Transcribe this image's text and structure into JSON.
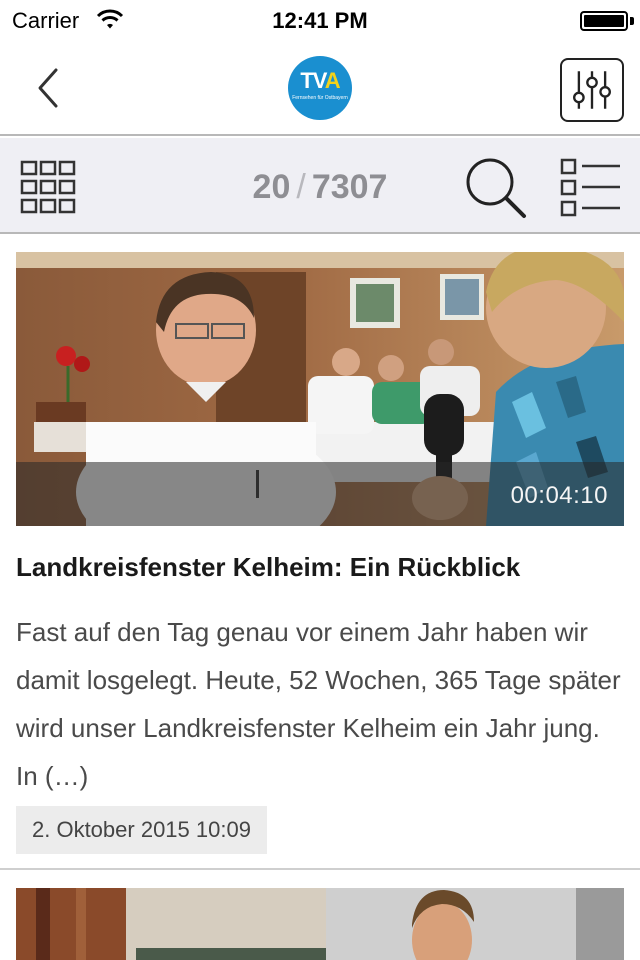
{
  "status_bar": {
    "carrier": "Carrier",
    "time": "12:41 PM",
    "icons": [
      "wifi-icon",
      "battery-icon"
    ]
  },
  "nav": {
    "back_icon": "chevron-left-icon",
    "logo": {
      "text_main": "TV",
      "text_accent": "A",
      "subtitle": "Fernsehen für Ostbayern"
    },
    "filter_icon": "sliders-icon"
  },
  "toolbar": {
    "grid_icon": "grid-icon",
    "current": "20",
    "separator": "/",
    "total": "7307",
    "search_icon": "search-icon",
    "list_icon": "list-icon"
  },
  "articles": [
    {
      "title": "Landkreisfenster Kelheim: Ein Rückblick",
      "teaser": "Fast auf den Tag genau vor einem Jahr haben wir damit losgelegt. Heute, 52 Wochen, 365 Tage später wird unser Landkreisfenster Kelheim ein Jahr jung. In (…)",
      "date": "2. Oktober 2015 10:09",
      "duration": "00:04:10"
    }
  ],
  "colors": {
    "toolbar_bg": "#efeff4",
    "logo_blue": "#1a8fd0",
    "logo_yellow": "#f2d21b",
    "counter_gray": "#8e8e93"
  }
}
